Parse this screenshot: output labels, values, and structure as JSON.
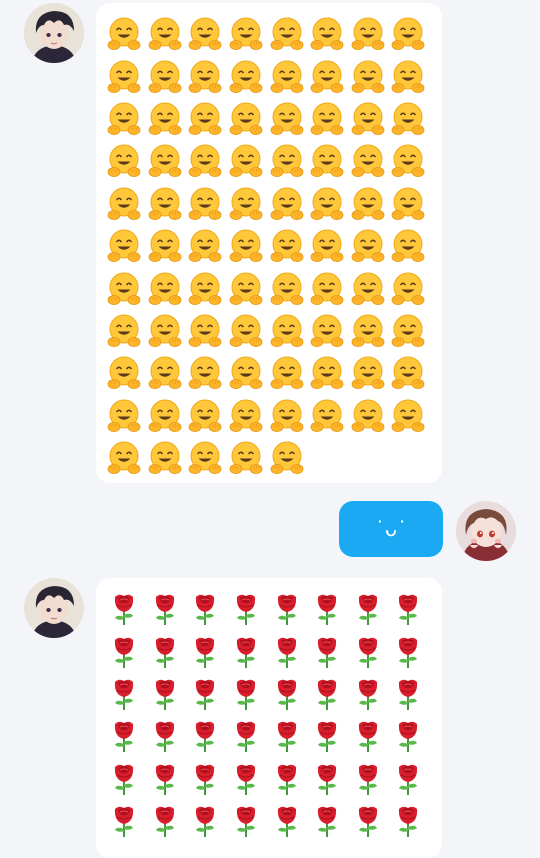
{
  "messages": [
    {
      "side": "left",
      "avatar": "dark-haired-boy-avatar",
      "content_type": "emoji-grid",
      "emoji": "🤗",
      "emoji_icon": "hugging-face-icon",
      "count": 85
    },
    {
      "side": "right",
      "avatar": "brown-haired-girl-avatar",
      "content_type": "text",
      "text": "˙ᴗ˙",
      "bubble_color": "#1aa9f2",
      "text_color": "#ffffff"
    },
    {
      "side": "left",
      "avatar": "dark-haired-boy-avatar",
      "content_type": "emoji-grid",
      "emoji": "🌹",
      "emoji_icon": "rose-icon",
      "visible_rows": 6,
      "columns": 8
    }
  ],
  "colors": {
    "background": "#f4f5f9",
    "bubble_in": "#ffffff",
    "bubble_out": "#1aa9f2"
  }
}
